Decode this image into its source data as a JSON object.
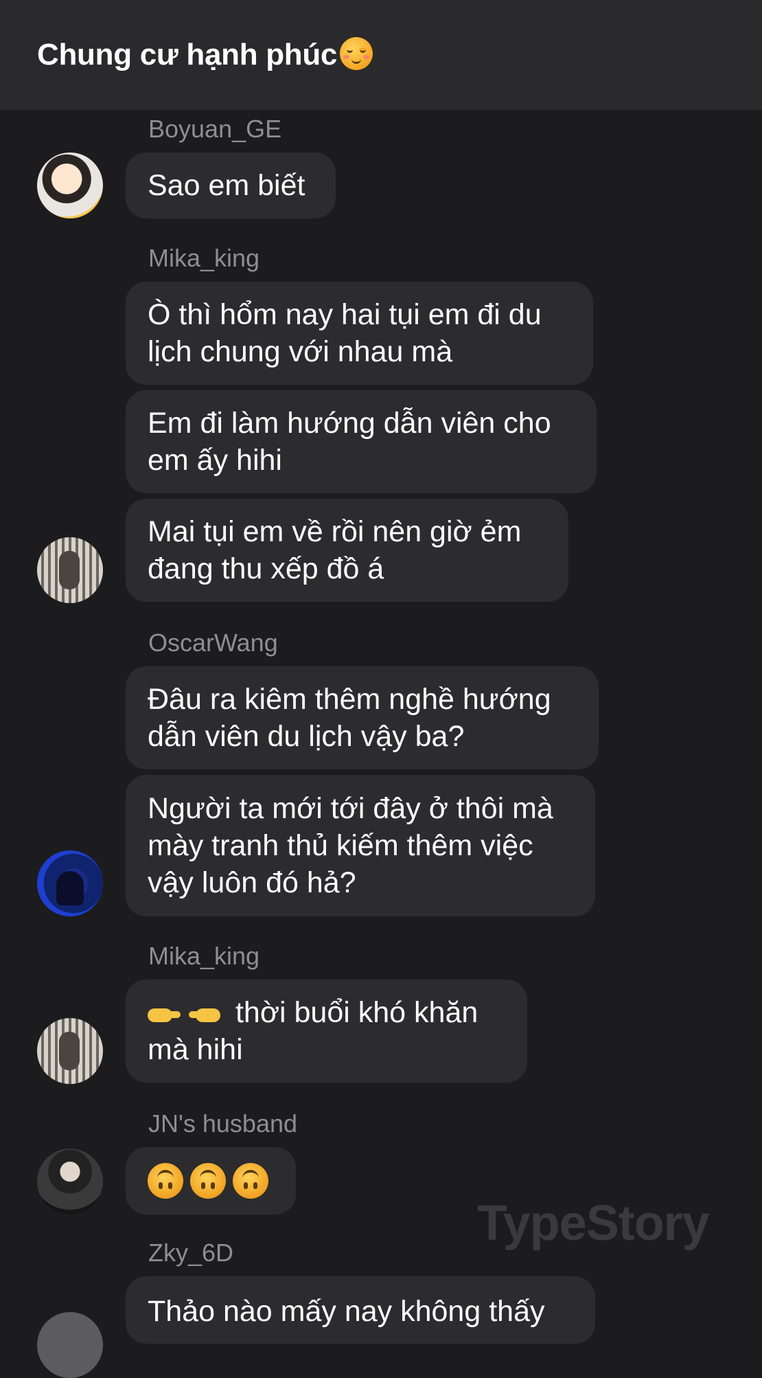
{
  "header": {
    "title": "Chung cư hạnh phúc"
  },
  "messages": [
    {
      "sender": "Boyuan_GE",
      "bubbles": [
        "Sao em biết"
      ]
    },
    {
      "sender": "Mika_king",
      "bubbles": [
        "Ò thì hổm nay hai tụi em đi du lịch chung với nhau mà",
        "Em đi làm hướng dẫn viên cho em ấy hihi",
        "Mai tụi em về rồi nên giờ ẻm đang thu xếp đồ á"
      ]
    },
    {
      "sender": "OscarWang",
      "bubbles": [
        "Đâu ra kiêm thêm nghề hướng dẫn viên du lịch vậy ba?",
        "Người ta mới tới đây ở thôi mà mày tranh thủ kiếm thêm việc vậy luôn đó hả?"
      ]
    },
    {
      "sender": "Mika_king",
      "bubbles": [
        "thời buổi khó khăn mà hihi"
      ]
    },
    {
      "sender": "JN's husband",
      "bubbles": []
    },
    {
      "sender": "Zky_6D",
      "bubbles": [
        "Thảo nào mấy nay không thấy"
      ]
    }
  ],
  "watermark": "TypeStory",
  "icons": {
    "header_emoji": "smiling-face-icon",
    "hands": "pointing-hands-icon",
    "upside_down": "upside-down-face-icon"
  }
}
